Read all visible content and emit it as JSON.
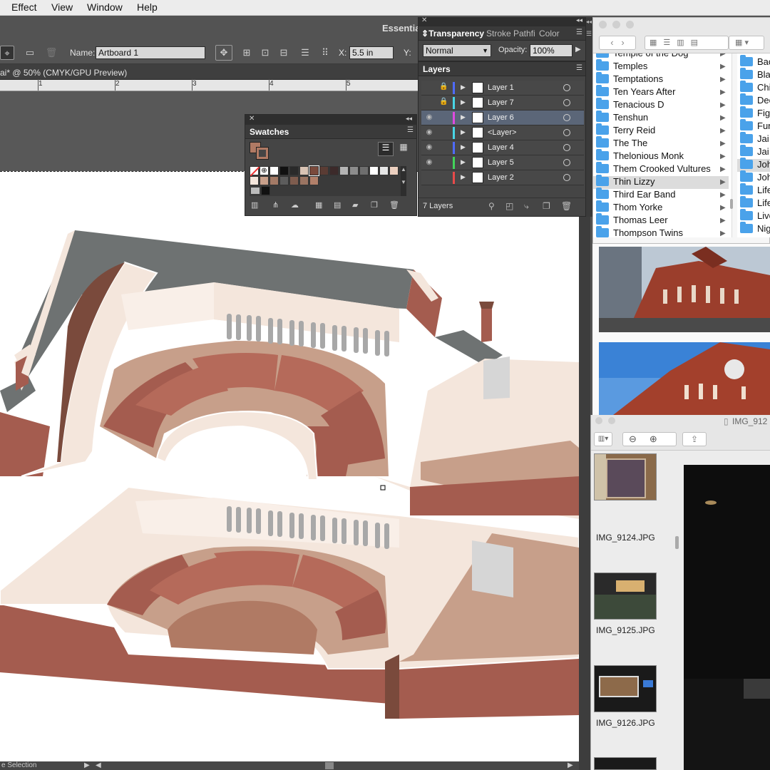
{
  "menubar": {
    "items": [
      "Effect",
      "View",
      "Window",
      "Help"
    ]
  },
  "control_bar": {
    "workspace": "Essentia",
    "name_label": "Name:",
    "artboard_name": "Artboard 1",
    "x_label": "X:",
    "x_value": "5.5 in",
    "y_label": "Y:"
  },
  "document": {
    "tab_title": "ai* @ 50% (CMYK/GPU Preview)",
    "ruler_ticks": [
      "1",
      "2",
      "3",
      "4",
      "5"
    ]
  },
  "transparency_panel": {
    "tabs": [
      "Transparency",
      "Stroke",
      "Pathfi",
      "Color"
    ],
    "blend_mode": "Normal",
    "opacity_label": "Opacity:",
    "opacity_value": "100%"
  },
  "layers_panel": {
    "title": "Layers",
    "layers": [
      {
        "name": "Layer 1",
        "visible": false,
        "locked": true,
        "color": "#4f6bff",
        "selected": false
      },
      {
        "name": "Layer 7",
        "visible": false,
        "locked": true,
        "color": "#48d6e6",
        "selected": false
      },
      {
        "name": "Layer 6",
        "visible": true,
        "locked": false,
        "color": "#e04ae0",
        "selected": true
      },
      {
        "name": "<Layer>",
        "visible": true,
        "locked": false,
        "color": "#48d6e6",
        "selected": false
      },
      {
        "name": "Layer 4",
        "visible": true,
        "locked": false,
        "color": "#4f6bff",
        "selected": false
      },
      {
        "name": "Layer 5",
        "visible": true,
        "locked": false,
        "color": "#42d45a",
        "selected": false
      },
      {
        "name": "Layer 2",
        "visible": false,
        "locked": false,
        "color": "#e84a4a",
        "selected": false
      }
    ],
    "count_label": "7 Layers"
  },
  "swatches_panel": {
    "title": "Swatches",
    "swatches": [
      "#ffffff",
      "#111111",
      "#2a2a2a",
      "#d9c3b4",
      "#7a4a3c",
      "#5a3c34",
      "#3c2a2a",
      "#b4b4b4",
      "#8c8c8c",
      "#6e6e6e",
      "#ffffff",
      "#e6e6e6",
      "#ecd0c0",
      "#f4e6dc",
      "#c79f8a",
      "#a37a66",
      "#5c5c5c",
      "#7e5c4e",
      "#9a7462",
      "#b2806a"
    ]
  },
  "finder": {
    "column1": [
      "Temple of the Dog",
      "Temples",
      "Temptations",
      "Ten Years After",
      "Tenacious D",
      "Tenshun",
      "Terry Reid",
      "The The",
      "Thelonious Monk",
      "Them Crooked Vultures",
      "Thin Lizzy",
      "Third Ear Band",
      "Thom Yorke",
      "Thomas Leer",
      "Thompson Twins"
    ],
    "selected": "Thin Lizzy",
    "column2": [
      "Bac",
      "Bla",
      "Chi",
      "Dec",
      "Fig",
      "Fun",
      "Jai",
      "Jai",
      "Joh",
      "Joh",
      "Life",
      "Life",
      "Live",
      "Nig"
    ]
  },
  "preview": {
    "title": "IMG_912",
    "photos": [
      "IMG_9124.JPG",
      "IMG_9125.JPG",
      "IMG_9126.JPG"
    ]
  },
  "status": {
    "text": "e Selection"
  },
  "colors": {
    "accent_blue": "#3d7ce0",
    "illustration_brick": "#a45c4f",
    "illustration_cream": "#f4e6dc",
    "illustration_roof": "#6e7272"
  }
}
